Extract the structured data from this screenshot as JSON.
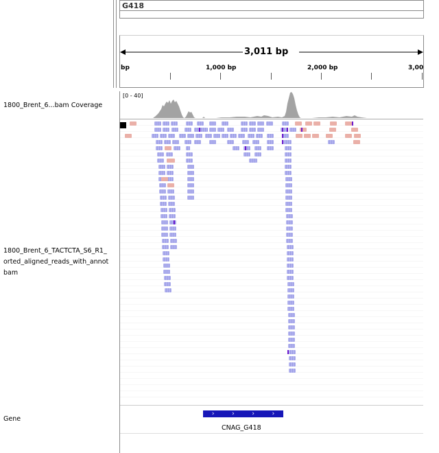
{
  "locus": {
    "name": "G418",
    "span_label": "3,011 bp",
    "ruler_ticks": [
      {
        "label": "bp"
      },
      {
        "label": "1,000 bp"
      },
      {
        "label": "2,000 bp"
      },
      {
        "label": "3,00"
      }
    ]
  },
  "tracks": {
    "coverage": {
      "label": "1800_Brent_6...bam Coverage",
      "range": "[0 - 40]",
      "color": "#a3a3a3"
    },
    "alignment": {
      "label_lines": [
        "1800_Brent_6_TACTCTA_S6_R1_",
        "orted_aligned_reads_with_annot",
        "bam"
      ],
      "read_color": "#a9aaec",
      "pair_color": "#eab0a8",
      "mismatch_color": "#6b16cc"
    },
    "gene": {
      "label": "Gene",
      "feature_name": "CNAG_G418",
      "feature_color": "#1717b8",
      "strand_glyphs": [
        "›",
        "›",
        "›",
        "›",
        "›"
      ]
    }
  }
}
